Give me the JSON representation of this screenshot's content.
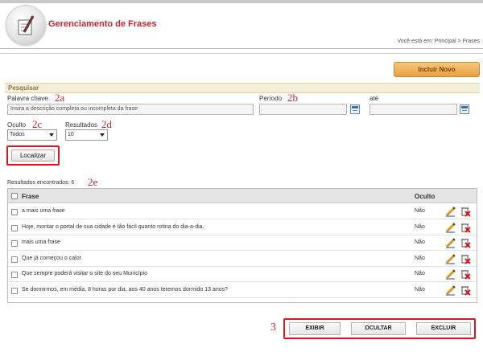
{
  "header": {
    "title": "Gerenciamento de Frases",
    "breadcrumb": "Você está em: Principal > Frases"
  },
  "toolbar": {
    "incluir_label": "Incluir Novo"
  },
  "search": {
    "section_title": "Pesquisar",
    "keyword_label": "Palavra chave",
    "keyword_placeholder": "Insira a descrição completa ou incompleta da frase",
    "period_label": "Período",
    "until_label": "até",
    "hidden_label": "Oculto",
    "hidden_value": "Todos",
    "results_label": "Resultados",
    "results_value": "10",
    "search_button": "Localizar"
  },
  "annotations": {
    "a": "2a",
    "b": "2b",
    "c": "2c",
    "d": "2d",
    "e": "2e",
    "three": "3"
  },
  "results": {
    "count_label": "Resultados encontrados: 6",
    "columns": {
      "phrase": "Frase",
      "hidden": "Oculto"
    },
    "rows": [
      {
        "phrase": "a mais uma frase",
        "hidden": "Não"
      },
      {
        "phrase": "Hoje, montar o portal de sua cidade é tão fácil quanto rotina do dia-a-dia.",
        "hidden": "Não"
      },
      {
        "phrase": "mais uma frase",
        "hidden": "Não"
      },
      {
        "phrase": "Que já começou o calor",
        "hidden": "Não"
      },
      {
        "phrase": "Que sempre poderá visitar o site do seu Município",
        "hidden": "Não"
      },
      {
        "phrase": "Se dormirmos, em média, 8 horas por dia, aos 40 anos teremos dormido 13 anos?",
        "hidden": "Não"
      }
    ]
  },
  "actions": {
    "show": "EXIBIR",
    "hide": "OCULTAR",
    "delete": "EXCLUIR"
  },
  "colors": {
    "accent_red": "#c0272d",
    "highlight_red": "#e0141e",
    "orange_button": "#e8a040"
  }
}
